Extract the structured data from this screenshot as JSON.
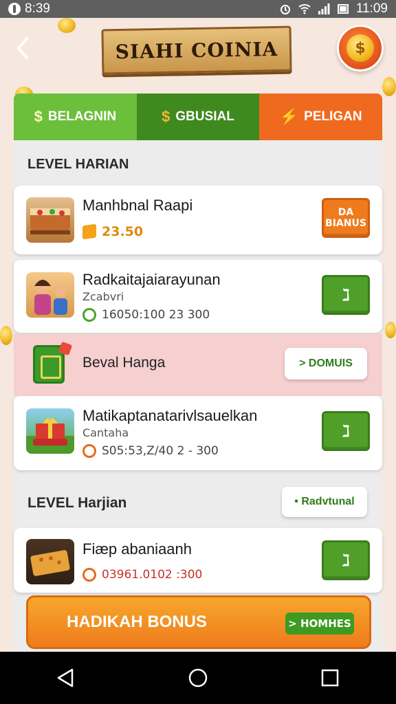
{
  "status_bar": {
    "left_text": "8:39",
    "time": "11:09"
  },
  "header": {
    "title": "SIAHI COINIA",
    "back_icon": "chevron-left-icon",
    "coin_icon": "coin-stack-icon"
  },
  "tabs": [
    {
      "label": "BELAGNIN",
      "icon": "$"
    },
    {
      "label": "GBUSIAL",
      "icon": "$"
    },
    {
      "label": "PELIGAN",
      "icon": "⚡"
    }
  ],
  "section1": {
    "title": "LEVEL HARIAN"
  },
  "items": [
    {
      "name": "Manhbnal Raapi",
      "meta": "23.50",
      "button_line1": "DA",
      "button_line2": "BIANUS"
    },
    {
      "name": "Radkaitajaiarayunan",
      "sub": "Zcabvri",
      "meta": "16050:100 23 300",
      "button": "ℷ"
    }
  ],
  "promo": {
    "label": "Beval Hanga",
    "button": "> DOMUIS"
  },
  "item3": {
    "name": "Matikaptanatarivlsauelkan",
    "sub": "Cantaha",
    "meta": "S05:53,Z/40 2 - 300",
    "button": "ℷ"
  },
  "section2": {
    "title": "LEVEL Harjian",
    "button": "• Radvtunal"
  },
  "item4": {
    "name": "Fiæp abaniaanh",
    "meta": "03961.0102 :300",
    "button": "ℷ"
  },
  "bonus": {
    "label": "HADIKAH BONUS",
    "button": "> HOMHES"
  },
  "colors": {
    "tab_green": "#6cbf3a",
    "tab_dark_green": "#3f8a1f",
    "tab_orange": "#ef6a1f",
    "action_green": "#4f9f29",
    "bonus_orange": "#ef7b1c"
  }
}
